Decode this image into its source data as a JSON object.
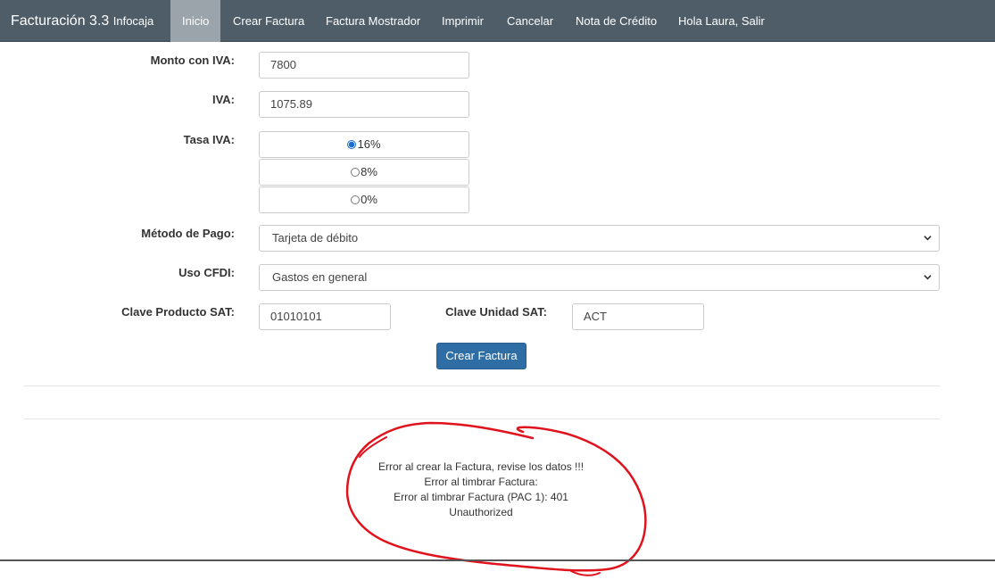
{
  "navbar": {
    "brand": "Facturación 3.3",
    "brand_sub": "Infocaja",
    "items": [
      {
        "label": "Inicio",
        "active": true
      },
      {
        "label": "Crear Factura"
      },
      {
        "label": "Factura Mostrador"
      },
      {
        "label": "Imprimir"
      },
      {
        "label": "Cancelar"
      },
      {
        "label": "Nota de Crédito"
      },
      {
        "label": "Hola Laura, Salir"
      }
    ]
  },
  "form": {
    "monto_label": "Monto con IVA:",
    "monto_value": "7800",
    "iva_label": "IVA:",
    "iva_value": "1075.89",
    "tasa_label": "Tasa IVA:",
    "tasa_options": [
      {
        "label": "16%",
        "checked": true
      },
      {
        "label": "8%",
        "checked": false
      },
      {
        "label": "0%",
        "checked": false
      }
    ],
    "metodo_label": "Método de Pago:",
    "metodo_value": "Tarjeta de débito",
    "uso_label": "Uso CFDI:",
    "uso_value": "Gastos en general",
    "clave_producto_label": "Clave Producto SAT:",
    "clave_producto_value": "01010101",
    "clave_unidad_label": "Clave Unidad SAT:",
    "clave_unidad_value": "ACT",
    "submit_label": "Crear Factura"
  },
  "error": {
    "lines": [
      "Error al crear la Factura, revise los datos !!!",
      "Error al timbrar Factura:",
      "Error al timbrar Factura (PAC 1): 401",
      "Unauthorized"
    ]
  },
  "colors": {
    "navbar": "#4e5d67",
    "nav_active": "#9aa4aa",
    "primary_button": "#2f6ea5",
    "annotation": "#e0121b"
  },
  "icons": {
    "select_arrow": "chevron-down-icon"
  }
}
